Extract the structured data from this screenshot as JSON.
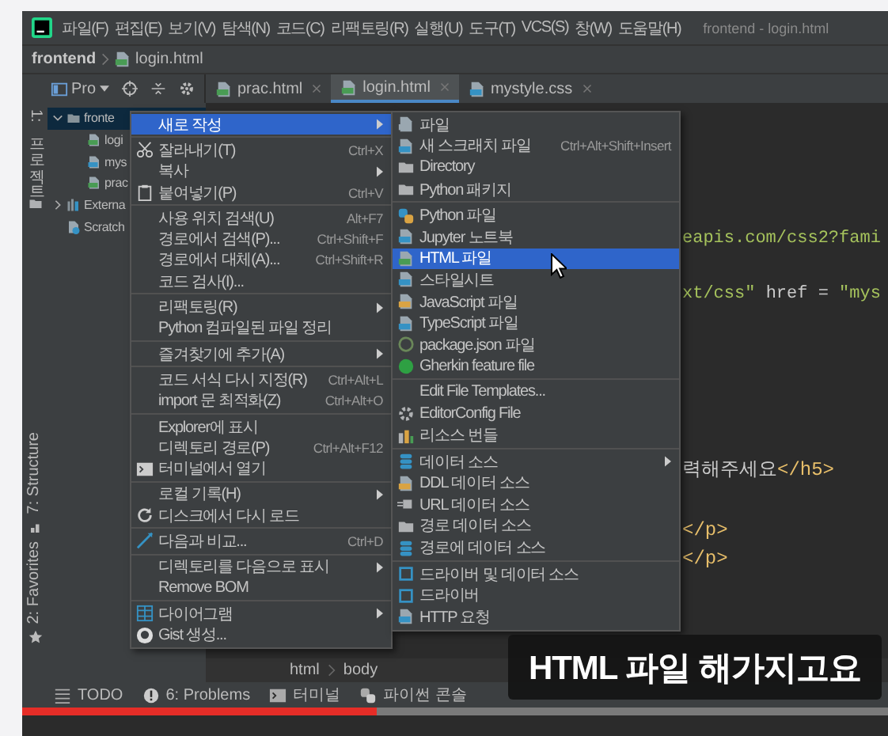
{
  "window": {
    "title": "frontend - login.html"
  },
  "menu_bar": [
    "파일(F)",
    "편집(E)",
    "보기(V)",
    "탐색(N)",
    "코드(C)",
    "리팩토링(R)",
    "실행(U)",
    "도구(T)",
    "VCS(S)",
    "창(W)",
    "도움말(H)"
  ],
  "breadcrumb": [
    "frontend",
    "login.html"
  ],
  "project_toolbar": {
    "label": "Pro"
  },
  "tabs": [
    {
      "label": "prac.html",
      "kind": "html",
      "selected": false
    },
    {
      "label": "login.html",
      "kind": "html",
      "selected": true
    },
    {
      "label": "mystyle.css",
      "kind": "css",
      "selected": false
    }
  ],
  "side_stripe": {
    "top": "1: 프로젝트",
    "structure": "7: Structure",
    "favorites": "2: Favorites"
  },
  "project_tree": [
    {
      "label": "fronte",
      "kind": "folder",
      "expanded": true,
      "selected": true,
      "children": [
        {
          "label": "logi",
          "kind": "html",
          "selected": false
        },
        {
          "label": "mys",
          "kind": "css",
          "selected": false
        },
        {
          "label": "prac",
          "kind": "html",
          "selected": false
        }
      ]
    },
    {
      "label": "Externa",
      "kind": "library",
      "expanded": false,
      "selected": false
    },
    {
      "label": "Scratch",
      "kind": "scratch",
      "selected": false
    }
  ],
  "context_menu": {
    "groups": [
      [
        {
          "label": "새로 작성",
          "kind": "plain",
          "submenu": true,
          "selected": true
        }
      ],
      [
        {
          "label": "잘라내기(T)",
          "shortcut": "Ctrl+X",
          "kind": "scissors",
          "submenu": false,
          "selected": false
        },
        {
          "label": "복사",
          "kind": "plain",
          "submenu": true,
          "selected": false
        },
        {
          "label": "붙여넣기(P)",
          "shortcut": "Ctrl+V",
          "kind": "clipboard",
          "submenu": false,
          "selected": false
        }
      ],
      [
        {
          "label": "사용 위치 검색(U)",
          "shortcut": "Alt+F7",
          "kind": "plain",
          "submenu": false,
          "selected": false
        },
        {
          "label": "경로에서 검색(P)...",
          "shortcut": "Ctrl+Shift+F",
          "kind": "plain",
          "submenu": false,
          "selected": false
        },
        {
          "label": "경로에서 대체(A)...",
          "shortcut": "Ctrl+Shift+R",
          "kind": "plain",
          "submenu": false,
          "selected": false
        },
        {
          "label": "코드 검사(I)...",
          "kind": "plain",
          "submenu": false,
          "selected": false
        }
      ],
      [
        {
          "label": "리팩토링(R)",
          "kind": "plain",
          "submenu": true,
          "selected": false
        },
        {
          "label": "Python 컴파일된 파일 정리",
          "kind": "plain",
          "submenu": false,
          "selected": false
        }
      ],
      [
        {
          "label": "즐겨찾기에 추가(A)",
          "kind": "plain",
          "submenu": true,
          "selected": false
        }
      ],
      [
        {
          "label": "코드 서식 다시 지정(R)",
          "shortcut": "Ctrl+Alt+L",
          "kind": "plain",
          "submenu": false,
          "selected": false
        },
        {
          "label": "import 문 최적화(Z)",
          "shortcut": "Ctrl+Alt+O",
          "kind": "plain",
          "submenu": false,
          "selected": false
        }
      ],
      [
        {
          "label": "Explorer에 표시",
          "kind": "plain",
          "submenu": false,
          "selected": false
        },
        {
          "label": "디렉토리 경로(P)",
          "shortcut": "Ctrl+Alt+F12",
          "kind": "plain",
          "submenu": false,
          "selected": false
        },
        {
          "label": "터미널에서 열기",
          "kind": "terminal",
          "submenu": false,
          "selected": false
        }
      ],
      [
        {
          "label": "로컬 기록(H)",
          "kind": "plain",
          "submenu": true,
          "selected": false
        },
        {
          "label": "디스크에서 다시 로드",
          "kind": "reload",
          "submenu": false,
          "selected": false
        }
      ],
      [
        {
          "label": "다음과 비교...",
          "shortcut": "Ctrl+D",
          "kind": "compare",
          "submenu": false,
          "selected": false
        }
      ],
      [
        {
          "label": "디렉토리를 다음으로 표시",
          "kind": "plain",
          "submenu": true,
          "selected": false
        },
        {
          "label": "Remove BOM",
          "kind": "plain",
          "submenu": false,
          "selected": false
        }
      ],
      [
        {
          "label": "다이어그램",
          "kind": "diagram",
          "submenu": true,
          "selected": false
        },
        {
          "label": "Gist 생성...",
          "kind": "octo",
          "submenu": false,
          "selected": false
        }
      ]
    ]
  },
  "submenu": {
    "groups": [
      [
        {
          "label": "파일",
          "kind": "file",
          "submenu": false,
          "selected": false
        },
        {
          "label": "새 스크래치 파일",
          "shortcut": "Ctrl+Alt+Shift+Insert",
          "kind": "scratch",
          "submenu": false,
          "selected": false
        },
        {
          "label": "Directory",
          "kind": "folder",
          "submenu": false,
          "selected": false
        },
        {
          "label": "Python 패키지",
          "kind": "package",
          "submenu": false,
          "selected": false
        }
      ],
      [
        {
          "label": "Python 파일",
          "kind": "python",
          "submenu": false,
          "selected": false
        },
        {
          "label": "Jupyter 노트북",
          "kind": "jupyter",
          "submenu": false,
          "selected": false
        },
        {
          "label": "HTML 파일",
          "kind": "html",
          "submenu": false,
          "selected": true
        },
        {
          "label": "스타일시트",
          "kind": "css",
          "submenu": false,
          "selected": false
        },
        {
          "label": "JavaScript 파일",
          "kind": "js",
          "submenu": false,
          "selected": false
        },
        {
          "label": "TypeScript 파일",
          "kind": "ts",
          "submenu": false,
          "selected": false
        },
        {
          "label": "package.json 파일",
          "kind": "npm",
          "submenu": false,
          "selected": false
        },
        {
          "label": "Gherkin feature file",
          "kind": "gherkin",
          "submenu": false,
          "selected": false
        }
      ],
      [
        {
          "label": "Edit File Templates...",
          "kind": "plain",
          "submenu": false,
          "selected": false
        },
        {
          "label": "EditorConfig File",
          "kind": "gear",
          "submenu": false,
          "selected": false
        },
        {
          "label": "리소스 번들",
          "kind": "bundle",
          "submenu": false,
          "selected": false
        }
      ],
      [
        {
          "label": "데이터 소스",
          "kind": "database",
          "submenu": true,
          "selected": false
        },
        {
          "label": "DDL 데이터 소스",
          "kind": "ddl",
          "submenu": false,
          "selected": false
        },
        {
          "label": "URL 데이터 소스",
          "kind": "url",
          "submenu": false,
          "selected": false
        },
        {
          "label": "경로 데이터 소스",
          "kind": "folder",
          "submenu": false,
          "selected": false
        },
        {
          "label": "경로에 데이터 소스",
          "kind": "database",
          "submenu": false,
          "selected": false
        }
      ],
      [
        {
          "label": "드라이버 및 데이터 소스",
          "kind": "driver",
          "submenu": false,
          "selected": false
        },
        {
          "label": "드라이버",
          "kind": "driver",
          "submenu": false,
          "selected": false
        },
        {
          "label": "HTTP 요청",
          "kind": "http",
          "submenu": false,
          "selected": false
        }
      ]
    ]
  },
  "code_lines": [
    [
      {
        "text": "eapis.com/css2?fami",
        "kind": "string"
      }
    ],
    [
      {
        "text": "xt/css\"",
        "kind": "string"
      },
      {
        "text": " href = ",
        "kind": "plain"
      },
      {
        "text": "\"mys",
        "kind": "string"
      }
    ],
    [
      {
        "text": "력해주세요",
        "kind": "plain"
      },
      {
        "text": "</h5>",
        "kind": "tag"
      }
    ],
    [
      {
        "text": "</p>",
        "kind": "tag"
      }
    ],
    [
      {
        "text": "</p>",
        "kind": "tag"
      }
    ]
  ],
  "editor_breadcrumb": [
    "html",
    "body"
  ],
  "bottom_tools": [
    {
      "label": "TODO",
      "kind": "list"
    },
    {
      "label": "6: Problems",
      "kind": "problems"
    },
    {
      "label": "터미널",
      "kind": "terminal"
    },
    {
      "label": "파이썬 콘솔",
      "kind": "python"
    }
  ],
  "subtitle": "HTML 파일 해가지고요",
  "video_progress": {
    "level": 0.41
  }
}
